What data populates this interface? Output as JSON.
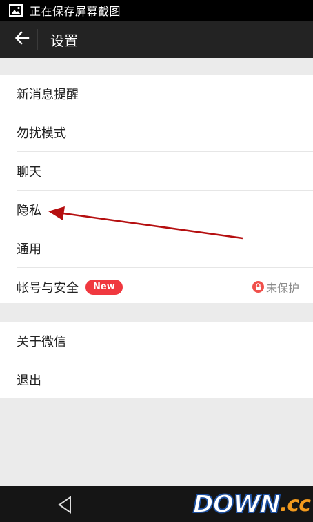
{
  "status_bar": {
    "text": "正在保存屏幕截图",
    "icon": "image-icon"
  },
  "header": {
    "title": "设置",
    "back_icon": "arrow-left-icon"
  },
  "groups": [
    {
      "items": [
        {
          "label": "新消息提醒"
        },
        {
          "label": "勿扰模式"
        },
        {
          "label": "聊天"
        },
        {
          "label": "隐私"
        },
        {
          "label": "通用"
        },
        {
          "label": "帐号与安全",
          "badge": "New",
          "status": "未保护",
          "status_icon": "lock-icon"
        }
      ]
    },
    {
      "items": [
        {
          "label": "关于微信"
        },
        {
          "label": "退出"
        }
      ]
    }
  ],
  "annotation": {
    "type": "red-arrow",
    "points_to": "隐私"
  },
  "watermark": {
    "main": "DOWN",
    "suffix": ".cc"
  },
  "colors": {
    "badge": "#f0383f",
    "lock": "#f0504b",
    "title_bar": "#232323",
    "arrow": "#b50f10"
  }
}
